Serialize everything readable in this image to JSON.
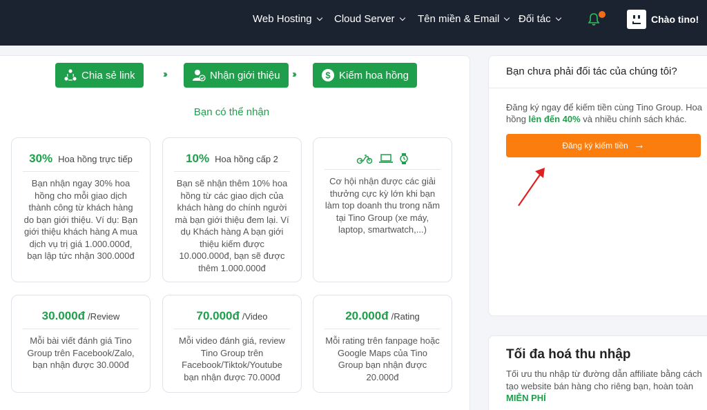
{
  "nav": {
    "items": [
      {
        "label": "Web Hosting"
      },
      {
        "label": "Cloud Server"
      },
      {
        "label": "Tên miền & Email"
      },
      {
        "label": "Đối tác"
      }
    ],
    "greeting": "Chào tino!"
  },
  "steps": [
    {
      "label": "Chia sẻ link",
      "icon": "share-icon"
    },
    {
      "label": "Nhận giới thiệu",
      "icon": "user-check-icon"
    },
    {
      "label": "Kiếm hoa hồng",
      "icon": "dollar-icon"
    }
  ],
  "subtitle": "Bạn có thể nhận",
  "cards": [
    {
      "big": "30%",
      "small": "Hoa hồng trực tiếp",
      "body": "Bạn nhận ngay 30% hoa hồng cho mỗi giao dịch thành công từ khách hàng do bạn giới thiệu. Ví dụ: Bạn giới thiệu khách hàng A mua dịch vụ trị giá 1.000.000đ, bạn lập tức nhận 300.000đ"
    },
    {
      "big": "10%",
      "small": "Hoa hồng cấp 2",
      "body": "Bạn sẽ nhận thêm 10% hoa hồng từ các giao dịch của khách hàng do chính người mà bạn giới thiệu đem lại. Ví dụ Khách hàng A bạn giới thiệu kiếm được 10.000.000đ, bạn sẽ được thêm 1.000.000đ"
    },
    {
      "icons": [
        "motorbike-icon",
        "laptop-icon",
        "smartwatch-icon"
      ],
      "body": "Cơ hội nhận được các giải thưởng cực kỳ lớn khi bạn làm top doanh thu trong năm tại Tino Group (xe máy, laptop, smartwatch,...)"
    },
    {
      "big": "30.000đ",
      "small": "/Review",
      "body": "Mỗi bài viết đánh giá Tino Group trên Facebook/Zalo, bạn nhận được 30.000đ"
    },
    {
      "big": "70.000đ",
      "small": "/Video",
      "body": "Mỗi video đánh giá, review Tino Group trên Facebook/Tiktok/Youtube bạn nhận được 70.000đ"
    },
    {
      "big": "20.000đ",
      "small": "/Rating",
      "body": "Mỗi rating trên fanpage hoặc Google Maps của Tino Group bạn nhận được 20.000đ"
    }
  ],
  "partner": {
    "title": "Bạn chưa phải đối tác của chúng tôi?",
    "text_before": "Đăng ký ngay để kiếm tiền cùng Tino Group. Hoa hồng ",
    "text_highlight": "lên đến 40%",
    "text_after": " và nhiều chính sách khác.",
    "cta": "Đăng ký kiếm tiền"
  },
  "maximize": {
    "title": "Tối đa hoá thu nhập",
    "text": "Tối ưu thu nhập từ đường dẫn affiliate bằng cách tạo website bán hàng cho riêng bạn, hoàn toàn",
    "highlight": "MIỄN PHÍ"
  },
  "colors": {
    "nav_bg": "#1b2230",
    "green": "#1f9e4b",
    "orange": "#fb7d0e",
    "annotation_arrow": "#e02020"
  }
}
